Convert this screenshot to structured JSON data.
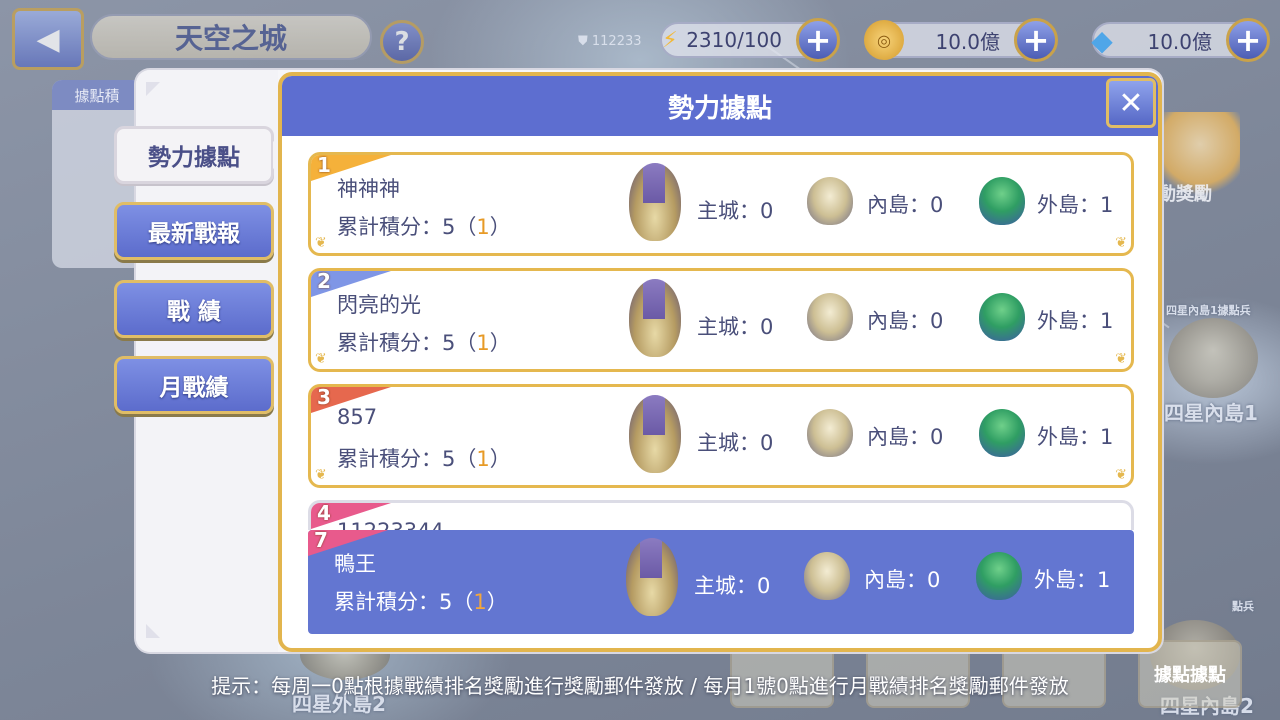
{
  "top_bar": {
    "title": "天空之城",
    "help_label": "?",
    "power_value": "112233",
    "resources": [
      {
        "name": "stamina",
        "icon": "lightning-icon",
        "value": "2310/100",
        "plus_label": "+"
      },
      {
        "name": "gold",
        "icon": "coin-icon",
        "value": "10.0億",
        "plus_label": "+"
      },
      {
        "name": "diamond",
        "icon": "diamond-icon",
        "value": "10.0億",
        "plus_label": "+"
      }
    ]
  },
  "side_panel": {
    "header": "據點積"
  },
  "tabs": [
    {
      "label": "勢力據點",
      "active": true
    },
    {
      "label": "最新戰報",
      "active": false
    },
    {
      "label": "戰 績",
      "active": false
    },
    {
      "label": "月戰績",
      "active": false
    }
  ],
  "panel": {
    "title": "勢力據點",
    "close_label": "✕",
    "stat_labels": {
      "main": "主城：",
      "inner": "內島：",
      "outer": "外島："
    },
    "score_prefix": "累計積分：",
    "rankings": [
      {
        "rank": "1",
        "name": "神神神",
        "score": "5",
        "score_extra": "1",
        "main": "0",
        "inner": "0",
        "outer": "1",
        "ribbon": "#f5b13a"
      },
      {
        "rank": "2",
        "name": "閃亮的光",
        "score": "5",
        "score_extra": "1",
        "main": "0",
        "inner": "0",
        "outer": "1",
        "ribbon": "#7f96e6"
      },
      {
        "rank": "3",
        "name": "857",
        "score": "5",
        "score_extra": "1",
        "main": "0",
        "inner": "0",
        "outer": "1",
        "ribbon": "#e6684e"
      },
      {
        "rank": "4",
        "name": "11223344",
        "ribbon": "#e85a8c"
      }
    ],
    "my_ranking": {
      "rank": "7",
      "name": "鴨王",
      "score": "5",
      "score_extra": "1",
      "main": "0",
      "inner": "0",
      "outer": "1",
      "ribbon": "#e85a8c"
    }
  },
  "hint": "提示：每周一0點根據戰績排名獎勵進行獎勵郵件發放 / 每月1號0點進行月戰績排名獎勵郵件發放",
  "background": {
    "reward_label": "動獎勵",
    "island_label_1": "四星內島1",
    "island_label_1_small": "四星內島1據點兵",
    "island_label_2": "四星內島2",
    "island_label_3": "四星外島2",
    "bottom_button": "據點據點",
    "small_label": "點兵"
  }
}
